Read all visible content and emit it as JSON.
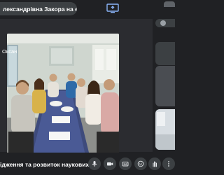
{
  "banner": {
    "presenter_text": "лександрівна Закора на екрані"
  },
  "participants": [
    {
      "name": "Оксан"
    }
  ],
  "meeting": {
    "title": "ідження та розвиток наукових ..."
  },
  "controls": [
    {
      "icon": "mic-icon"
    },
    {
      "icon": "camera-icon"
    },
    {
      "icon": "captions-icon"
    },
    {
      "icon": "emoji-icon"
    },
    {
      "icon": "present-screen-icon"
    },
    {
      "icon": "raise-hand-icon"
    },
    {
      "icon": "more-options-icon"
    },
    {
      "icon": "end-call-icon"
    }
  ],
  "colors": {
    "background": "#202124",
    "surface": "#3c4043",
    "end_call": "#ea4335",
    "accent": "#8ab4f8"
  }
}
